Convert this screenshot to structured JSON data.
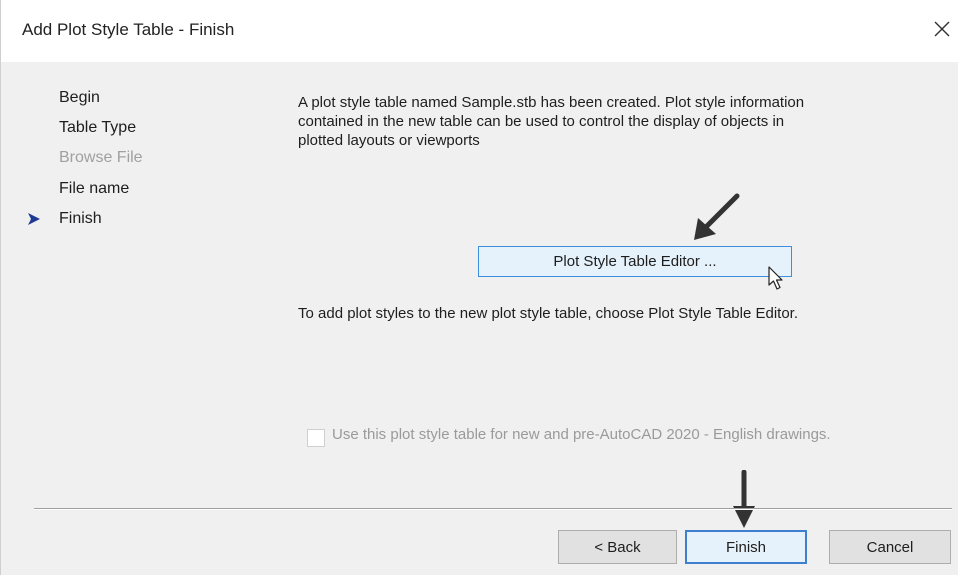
{
  "window": {
    "title": "Add Plot Style Table - Finish",
    "close_icon": "close-icon"
  },
  "steps": [
    {
      "label": "Begin",
      "state": "normal"
    },
    {
      "label": "Table Type",
      "state": "normal"
    },
    {
      "label": "Browse File",
      "state": "disabled"
    },
    {
      "label": "File name",
      "state": "normal"
    },
    {
      "label": "Finish",
      "state": "current"
    }
  ],
  "content": {
    "intro_text": "A plot style table named Sample.stb has been created. Plot style information contained in the new table can be used to control the display of objects in plotted layouts or viewports",
    "editor_button_label": "Plot Style Table Editor ...",
    "instruction_text": "To add plot styles to the new plot style table, choose Plot Style Table Editor.",
    "checkbox_label": "Use this plot style table for new and pre-AutoCAD 2020 - English drawings.",
    "checkbox_checked": false,
    "checkbox_enabled": false
  },
  "buttons": {
    "back": "< Back",
    "finish": "Finish",
    "cancel": "Cancel"
  },
  "colors": {
    "accent": "#3d8ee0",
    "marker": "#1f3a93",
    "disabled_text": "#a0a0a0"
  }
}
